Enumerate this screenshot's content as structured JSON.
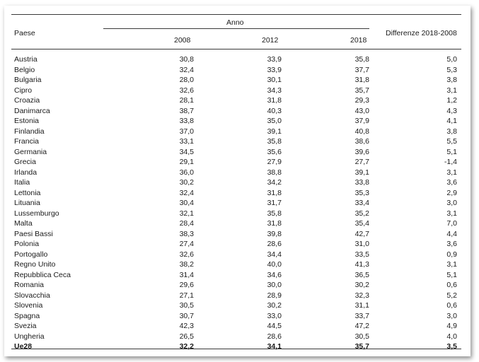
{
  "table": {
    "header": {
      "country": "Paese",
      "group": "Anno",
      "years": [
        "2008",
        "2012",
        "2018"
      ],
      "difference": "Differenze 2018-2008"
    },
    "rows": [
      {
        "country": "Austria",
        "v2008": "30,8",
        "v2012": "33,9",
        "v2018": "35,8",
        "diff": "5,0"
      },
      {
        "country": "Belgio",
        "v2008": "32,4",
        "v2012": "33,9",
        "v2018": "37,7",
        "diff": "5,3"
      },
      {
        "country": "Bulgaria",
        "v2008": "28,0",
        "v2012": "30,1",
        "v2018": "31,8",
        "diff": "3,8"
      },
      {
        "country": "Cipro",
        "v2008": "32,6",
        "v2012": "34,3",
        "v2018": "35,7",
        "diff": "3,1"
      },
      {
        "country": "Croazia",
        "v2008": "28,1",
        "v2012": "31,8",
        "v2018": "29,3",
        "diff": "1,2"
      },
      {
        "country": "Danimarca",
        "v2008": "38,7",
        "v2012": "40,3",
        "v2018": "43,0",
        "diff": "4,3"
      },
      {
        "country": "Estonia",
        "v2008": "33,8",
        "v2012": "35,0",
        "v2018": "37,9",
        "diff": "4,1"
      },
      {
        "country": "Finlandia",
        "v2008": "37,0",
        "v2012": "39,1",
        "v2018": "40,8",
        "diff": "3,8"
      },
      {
        "country": "Francia",
        "v2008": "33,1",
        "v2012": "35,8",
        "v2018": "38,6",
        "diff": "5,5"
      },
      {
        "country": "Germania",
        "v2008": "34,5",
        "v2012": "35,6",
        "v2018": "39,6",
        "diff": "5,1"
      },
      {
        "country": "Grecia",
        "v2008": "29,1",
        "v2012": "27,9",
        "v2018": "27,7",
        "diff": "-1,4"
      },
      {
        "country": "Irlanda",
        "v2008": "36,0",
        "v2012": "38,8",
        "v2018": "39,1",
        "diff": "3,1"
      },
      {
        "country": "Italia",
        "v2008": "30,2",
        "v2012": "34,2",
        "v2018": "33,8",
        "diff": "3,6"
      },
      {
        "country": "Lettonia",
        "v2008": "32,4",
        "v2012": "31,8",
        "v2018": "35,3",
        "diff": "2,9"
      },
      {
        "country": "Lituania",
        "v2008": "30,4",
        "v2012": "31,7",
        "v2018": "33,4",
        "diff": "3,0"
      },
      {
        "country": "Lussemburgo",
        "v2008": "32,1",
        "v2012": "35,8",
        "v2018": "35,2",
        "diff": "3,1"
      },
      {
        "country": "Malta",
        "v2008": "28,4",
        "v2012": "31,8",
        "v2018": "35,4",
        "diff": "7,0"
      },
      {
        "country": "Paesi Bassi",
        "v2008": "38,3",
        "v2012": "39,8",
        "v2018": "42,7",
        "diff": "4,4"
      },
      {
        "country": "Polonia",
        "v2008": "27,4",
        "v2012": "28,6",
        "v2018": "31,0",
        "diff": "3,6"
      },
      {
        "country": "Portogallo",
        "v2008": "32,6",
        "v2012": "34,4",
        "v2018": "33,5",
        "diff": "0,9"
      },
      {
        "country": "Regno Unito",
        "v2008": "38,2",
        "v2012": "40,0",
        "v2018": "41,3",
        "diff": "3,1"
      },
      {
        "country": "Repubblica Ceca",
        "v2008": "31,4",
        "v2012": "34,6",
        "v2018": "36,5",
        "diff": "5,1"
      },
      {
        "country": "Romania",
        "v2008": "29,6",
        "v2012": "30,0",
        "v2018": "30,2",
        "diff": "0,6"
      },
      {
        "country": "Slovacchia",
        "v2008": "27,1",
        "v2012": "28,9",
        "v2018": "32,3",
        "diff": "5,2"
      },
      {
        "country": "Slovenia",
        "v2008": "30,5",
        "v2012": "30,2",
        "v2018": "31,1",
        "diff": "0,6"
      },
      {
        "country": "Spagna",
        "v2008": "30,7",
        "v2012": "33,0",
        "v2018": "33,7",
        "diff": "3,0"
      },
      {
        "country": "Svezia",
        "v2008": "42,3",
        "v2012": "44,5",
        "v2018": "47,2",
        "diff": "4,9"
      },
      {
        "country": "Ungheria",
        "v2008": "26,5",
        "v2012": "28,6",
        "v2018": "30,5",
        "diff": "4,0"
      }
    ],
    "total": {
      "country": "Ue28",
      "v2008": "32,2",
      "v2012": "34,1",
      "v2018": "35,7",
      "diff": "3,5"
    }
  }
}
